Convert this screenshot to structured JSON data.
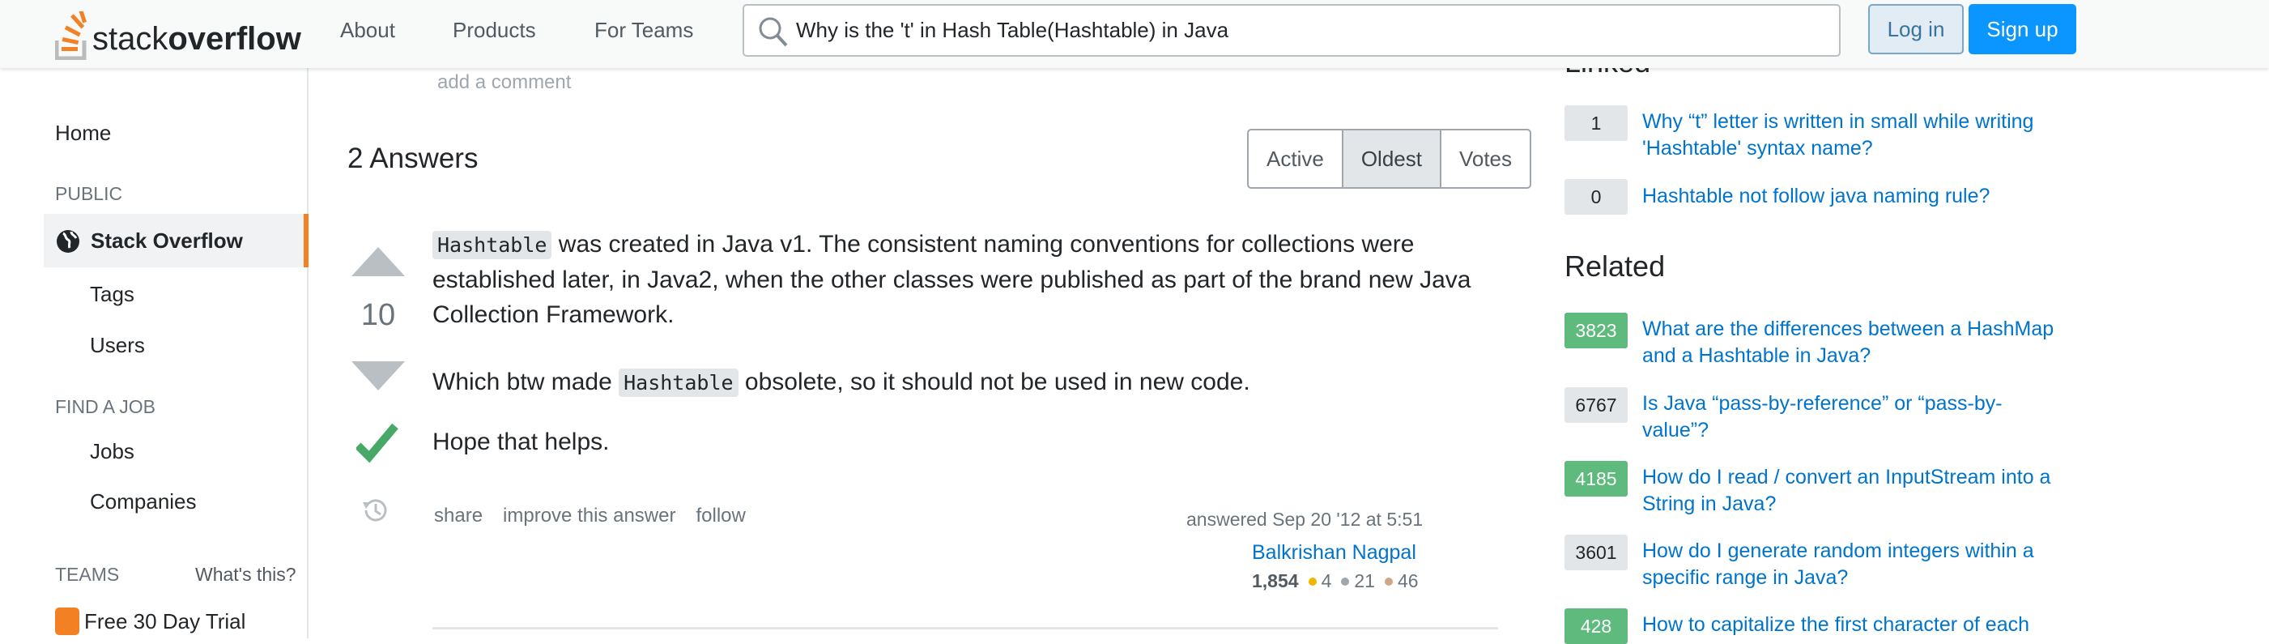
{
  "header": {
    "logo_text_light": "stack",
    "logo_text_bold": "overflow",
    "nav": [
      "About",
      "Products",
      "For Teams"
    ],
    "search_value": "Why is the 't' in Hash Table(Hashtable) in Java",
    "login": "Log in",
    "signup": "Sign up"
  },
  "sidebar": {
    "home": "Home",
    "public": "PUBLIC",
    "stack_overflow": "Stack Overflow",
    "tags": "Tags",
    "users": "Users",
    "find_job": "FIND A JOB",
    "jobs": "Jobs",
    "companies": "Companies",
    "teams": "TEAMS",
    "whats_this": "What's this?",
    "trial": "Free 30 Day Trial"
  },
  "main": {
    "add_comment": "add a comment",
    "answers_title": "2 Answers",
    "tabs": [
      {
        "label": "Active",
        "selected": false
      },
      {
        "label": "Oldest",
        "selected": true
      },
      {
        "label": "Votes",
        "selected": false
      }
    ],
    "answer": {
      "votes": "10",
      "accepted": true,
      "code": "Hashtable",
      "p1": " was created in Java v1. The consistent naming conventions for collections were established later, in Java2, when the other classes were published as part of the brand new Java Collection Framework.",
      "p2a": "Which btw made ",
      "p2b": " obsolete, so it should not be used in new code.",
      "p3": "Hope that helps.",
      "actions": [
        "share",
        "improve this answer",
        "follow"
      ],
      "answered": "answered Sep 20 '12 at 5:51",
      "user": "Balkrishan Nagpal",
      "rep": "1,854",
      "gold": "4",
      "silver": "21",
      "bronze": "46"
    }
  },
  "right": {
    "linked_title": "Linked",
    "linked": [
      {
        "count": "1",
        "title": "Why “t” letter is written in small while writing 'Hashtable' syntax name?"
      },
      {
        "count": "0",
        "title": "Hashtable not follow java naming rule?"
      }
    ],
    "related_title": "Related",
    "related": [
      {
        "count": "3823",
        "accepted": true,
        "title": "What are the differences between a HashMap and a Hashtable in Java?"
      },
      {
        "count": "6767",
        "accepted": false,
        "title": "Is Java “pass-by-reference” or “pass-by-value”?"
      },
      {
        "count": "4185",
        "accepted": true,
        "title": "How do I read / convert an InputStream into a String in Java?"
      },
      {
        "count": "3601",
        "accepted": false,
        "title": "How do I generate random integers within a specific range in Java?"
      },
      {
        "count": "428",
        "accepted": true,
        "title": "How to capitalize the first character of each"
      }
    ]
  },
  "colors": {
    "accent": "#f48024",
    "link": "#0074cc",
    "primary_button": "#0a95ff",
    "accepted": "#5eba7d"
  }
}
